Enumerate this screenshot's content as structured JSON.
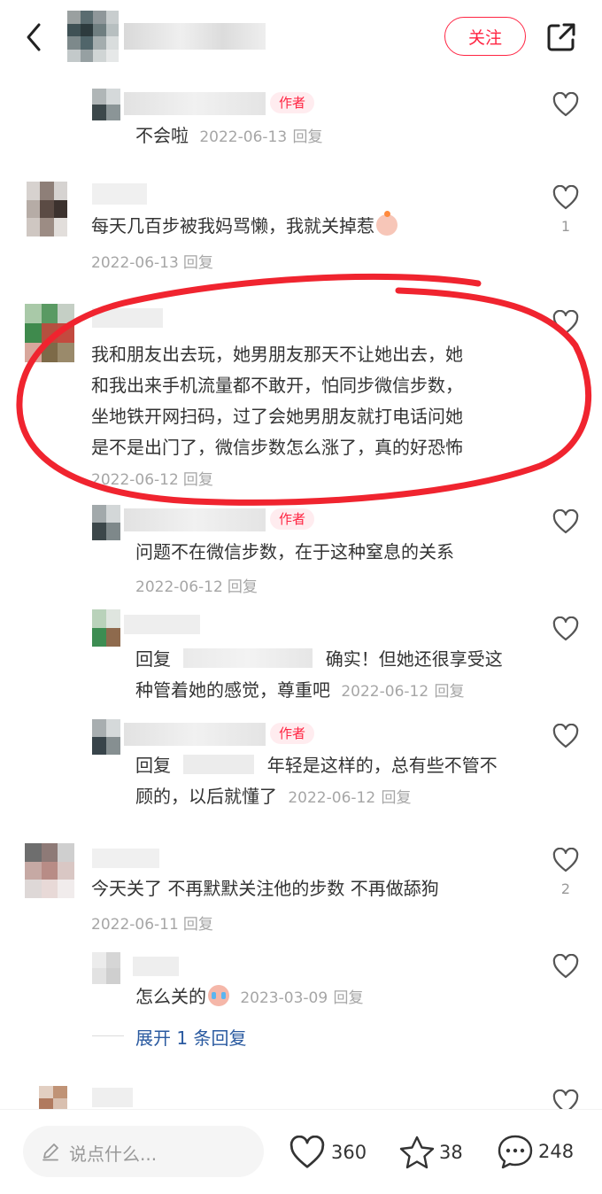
{
  "header": {
    "follow_label": "关注"
  },
  "labels": {
    "author_tag": "作者",
    "reply": "回复"
  },
  "comments": [
    {
      "text": "不会啦",
      "date": "2022-06-13",
      "reply_label": "回复"
    },
    {
      "text": "每天几百步被我妈骂懒，我就关掉惹",
      "date": "2022-06-13",
      "reply_label": "回复",
      "likes": "1"
    },
    {
      "lines": [
        "我和朋友出去玩，她男朋友那天不让她出去，她",
        "和我出来手机流量都不敢开，怕同步微信步数，",
        "坐地铁开网扫码，过了会她男朋友就打电话问她",
        "是不是出门了，微信步数怎么涨了，真的好恐怖"
      ],
      "date": "2022-06-12",
      "reply_label": "回复"
    },
    {
      "text": "问题不在微信步数，在于这种窒息的关系",
      "date": "2022-06-12",
      "reply_label": "回复"
    },
    {
      "prefix": "回复",
      "line1": "确实！但她还很享受这",
      "line2": "种管着她的感觉，尊重吧",
      "date": "2022-06-12",
      "reply_label": "回复"
    },
    {
      "prefix": "回复",
      "line1": "年轻是这样的，总有些不管不",
      "line2": "顾的，以后就懂了",
      "date": "2022-06-12",
      "reply_label": "回复"
    },
    {
      "text": "今天关了 不再默默关注他的步数 不再做舔狗",
      "date": "2022-06-11",
      "reply_label": "回复",
      "likes": "2"
    },
    {
      "text": "怎么关的",
      "date": "2023-03-09",
      "reply_label": "回复"
    }
  ],
  "expand_replies": "展开 1 条回复",
  "bottom_bar": {
    "input_placeholder": "说点什么...",
    "like_count": "360",
    "collect_count": "38",
    "comment_count": "248"
  },
  "colors": {
    "accent": "#ff2442",
    "annotation_circle": "#f0242f",
    "text": "#333333",
    "meta": "#a6a6a6"
  }
}
